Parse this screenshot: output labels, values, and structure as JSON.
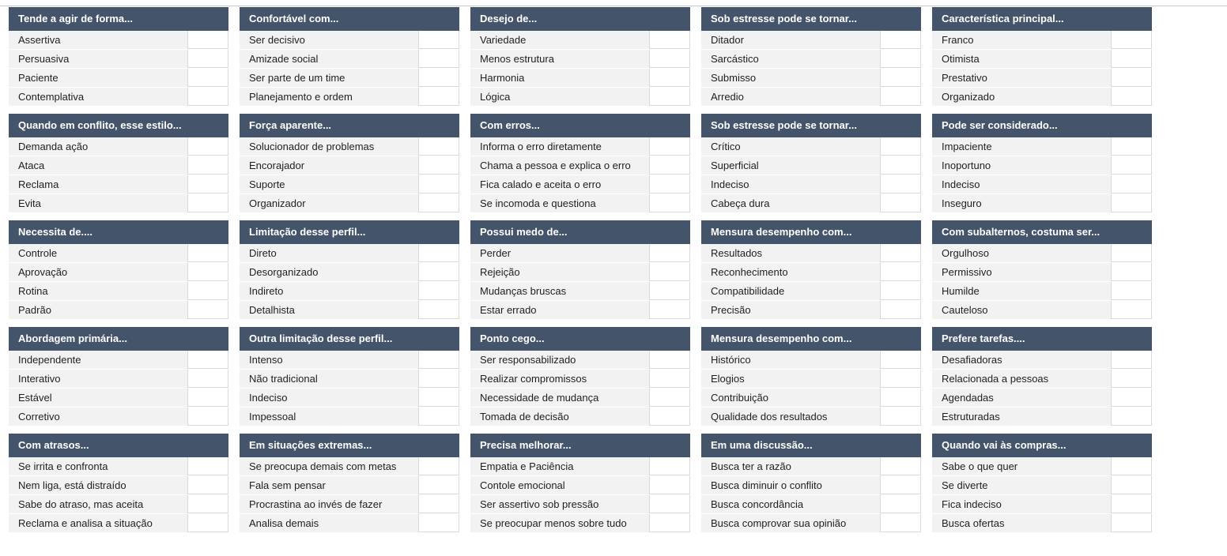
{
  "colors": {
    "header_bg": "#44546a",
    "header_text": "#ffffff",
    "row_bg": "#f2f2f2",
    "input_bg": "#ffffff"
  },
  "blocks": [
    {
      "title": "Tende a agir de forma...",
      "options": [
        "Assertiva",
        "Persuasiva",
        "Paciente",
        "Contemplativa"
      ]
    },
    {
      "title": "Confortável com...",
      "options": [
        "Ser decisivo",
        "Amizade social",
        "Ser parte de um time",
        "Planejamento e ordem"
      ]
    },
    {
      "title": "Desejo de...",
      "options": [
        "Variedade",
        "Menos estrutura",
        "Harmonia",
        "Lógica"
      ]
    },
    {
      "title": "Sob estresse pode se tornar...",
      "options": [
        "Ditador",
        "Sarcástico",
        "Submisso",
        "Arredio"
      ]
    },
    {
      "title": "Característica principal...",
      "options": [
        "Franco",
        "Otimista",
        "Prestativo",
        "Organizado"
      ]
    },
    {
      "title": "Quando em conflito, esse estilo...",
      "options": [
        "Demanda ação",
        "Ataca",
        "Reclama",
        "Evita"
      ]
    },
    {
      "title": "Força aparente...",
      "options": [
        "Solucionador de problemas",
        "Encorajador",
        "Suporte",
        "Organizador"
      ]
    },
    {
      "title": "Com erros...",
      "options": [
        "Informa o erro diretamente",
        "Chama a pessoa e explica o erro",
        "Fica calado e aceita o erro",
        "Se incomoda e questiona"
      ]
    },
    {
      "title": "Sob estresse pode se tornar...",
      "options": [
        "Crítico",
        "Superficial",
        "Indeciso",
        "Cabeça dura"
      ]
    },
    {
      "title": "Pode ser considerado...",
      "options": [
        "Impaciente",
        "Inoportuno",
        "Indeciso",
        "Inseguro"
      ]
    },
    {
      "title": "Necessita de....",
      "options": [
        "Controle",
        "Aprovação",
        "Rotina",
        "Padrão"
      ]
    },
    {
      "title": "Limitação desse perfil...",
      "options": [
        "Direto",
        "Desorganizado",
        "Indireto",
        "Detalhista"
      ]
    },
    {
      "title": "Possui medo de...",
      "options": [
        "Perder",
        "Rejeição",
        "Mudanças bruscas",
        "Estar errado"
      ]
    },
    {
      "title": "Mensura desempenho com...",
      "options": [
        "Resultados",
        "Reconhecimento",
        "Compatibilidade",
        "Precisão"
      ]
    },
    {
      "title": "Com subalternos, costuma ser...",
      "options": [
        "Orgulhoso",
        "Permissivo",
        "Humilde",
        "Cauteloso"
      ]
    },
    {
      "title": "Abordagem primária...",
      "options": [
        "Independente",
        "Interativo",
        "Estável",
        "Corretivo"
      ]
    },
    {
      "title": "Outra limitação desse perfil...",
      "options": [
        "Intenso",
        "Não tradicional",
        "Indeciso",
        "Impessoal"
      ]
    },
    {
      "title": "Ponto cego...",
      "options": [
        "Ser responsabilizado",
        "Realizar compromissos",
        "Necessidade de mudança",
        "Tomada de decisão"
      ]
    },
    {
      "title": "Mensura desempenho com...",
      "options": [
        "Histórico",
        "Elogios",
        "Contribuição",
        "Qualidade dos resultados"
      ]
    },
    {
      "title": "Prefere tarefas....",
      "options": [
        "Desafiadoras",
        "Relacionada a pessoas",
        "Agendadas",
        "Estruturadas"
      ]
    },
    {
      "title": "Com atrasos...",
      "options": [
        "Se irrita e confronta",
        "Nem liga, está distraído",
        "Sabe do atraso, mas aceita",
        "Reclama e analisa a situação"
      ]
    },
    {
      "title": "Em situações extremas...",
      "options": [
        "Se preocupa demais com metas",
        "Fala sem pensar",
        "Procrastina ao invés de fazer",
        "Analisa demais"
      ]
    },
    {
      "title": "Precisa melhorar...",
      "options": [
        "Empatia e Paciência",
        "Contole emocional",
        "Ser assertivo sob pressão",
        "Se preocupar menos sobre tudo"
      ]
    },
    {
      "title": "Em uma discussão...",
      "options": [
        "Busca ter a razão",
        "Busca diminuir o conflito",
        "Busca concordância",
        "Busca comprovar sua opinião"
      ]
    },
    {
      "title": "Quando vai às compras...",
      "options": [
        "Sabe o que quer",
        "Se diverte",
        "Fica indeciso",
        "Busca ofertas"
      ]
    }
  ]
}
